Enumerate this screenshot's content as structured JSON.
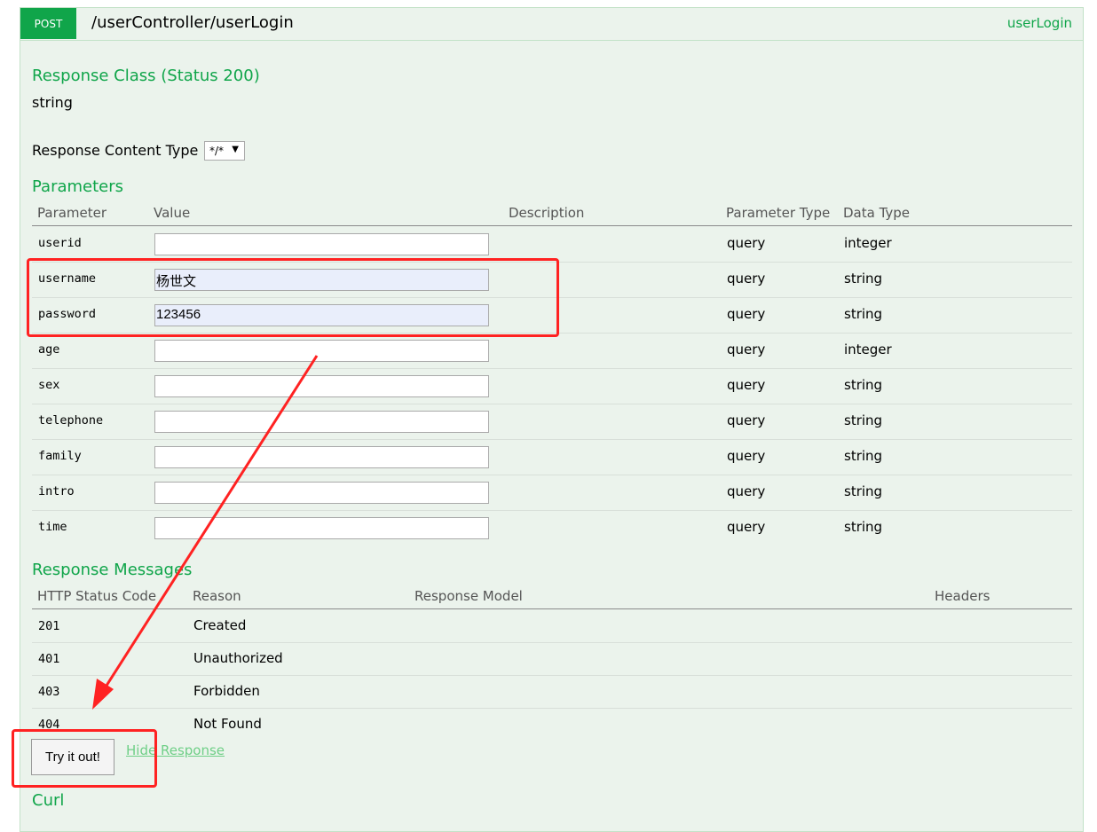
{
  "endpoint": {
    "method": "POST",
    "path": "/userController/userLogin",
    "nickname": "userLogin"
  },
  "response_class": {
    "heading": "Response Class (Status 200)",
    "type": "string"
  },
  "response_content_type": {
    "label": "Response Content Type",
    "selected": "*/*"
  },
  "parameters": {
    "heading": "Parameters",
    "columns": [
      "Parameter",
      "Value",
      "Description",
      "Parameter Type",
      "Data Type"
    ],
    "rows": [
      {
        "name": "userid",
        "value": "",
        "param_type": "query",
        "data_type": "integer"
      },
      {
        "name": "username",
        "value": "杨世文",
        "param_type": "query",
        "data_type": "string"
      },
      {
        "name": "password",
        "value": "123456",
        "param_type": "query",
        "data_type": "string"
      },
      {
        "name": "age",
        "value": "",
        "param_type": "query",
        "data_type": "integer"
      },
      {
        "name": "sex",
        "value": "",
        "param_type": "query",
        "data_type": "string"
      },
      {
        "name": "telephone",
        "value": "",
        "param_type": "query",
        "data_type": "string"
      },
      {
        "name": "family",
        "value": "",
        "param_type": "query",
        "data_type": "string"
      },
      {
        "name": "intro",
        "value": "",
        "param_type": "query",
        "data_type": "string"
      },
      {
        "name": "time",
        "value": "",
        "param_type": "query",
        "data_type": "string"
      }
    ]
  },
  "response_messages": {
    "heading": "Response Messages",
    "columns": [
      "HTTP Status Code",
      "Reason",
      "Response Model",
      "Headers"
    ],
    "rows": [
      {
        "code": "201",
        "reason": "Created"
      },
      {
        "code": "401",
        "reason": "Unauthorized"
      },
      {
        "code": "403",
        "reason": "Forbidden"
      },
      {
        "code": "404",
        "reason": "Not Found"
      }
    ]
  },
  "actions": {
    "try_label": "Try it out!",
    "hide_label": "Hide Response"
  },
  "curl": {
    "heading": "Curl"
  },
  "colors": {
    "accent": "#10a54a",
    "annotation": "#ff2222",
    "panel_bg": "#ebf3ec"
  }
}
